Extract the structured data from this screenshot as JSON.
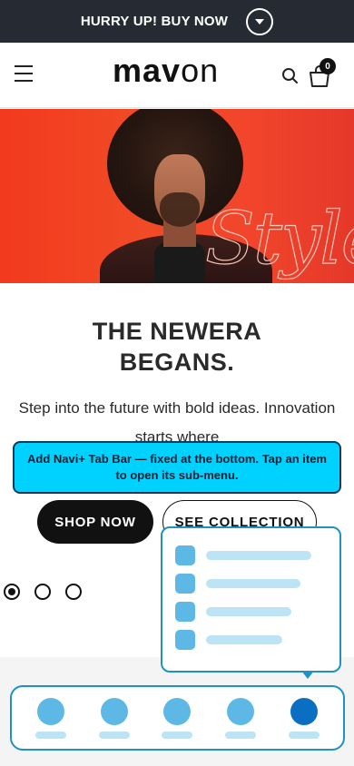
{
  "announcement": {
    "text": "HURRY UP! BUY NOW",
    "toggle_icon": "chevron-down-icon"
  },
  "header": {
    "logo_bold": "mav",
    "logo_light": "on",
    "menu_icon": "hamburger-icon",
    "search_icon": "search-icon",
    "cart_icon": "cart-icon",
    "cart_count": "0"
  },
  "hero": {
    "headline_line1": "THE NEWERA",
    "headline_line2": "BEGANS.",
    "subtext": "Step into the future with bold ideas. Innovation starts where",
    "shop_button": "SHOP NOW",
    "collection_button": "SEE COLLECTION",
    "slides_total": 3,
    "slide_active": 1
  },
  "tooltip": {
    "text": "Add Navi+ Tab Bar — fixed at the bottom. Tap an item to open its sub-menu."
  },
  "tab_bar": {
    "items": 5,
    "active_index": 4,
    "submenu_items": 4
  },
  "colors": {
    "announce_bg": "#252a33",
    "hero_bg": "#f23a1e",
    "tooltip_bg": "#00d2ff",
    "tabbar_border": "#1e92c4",
    "tab_icon": "#5db8e6",
    "tab_icon_active": "#0a6fc2"
  }
}
